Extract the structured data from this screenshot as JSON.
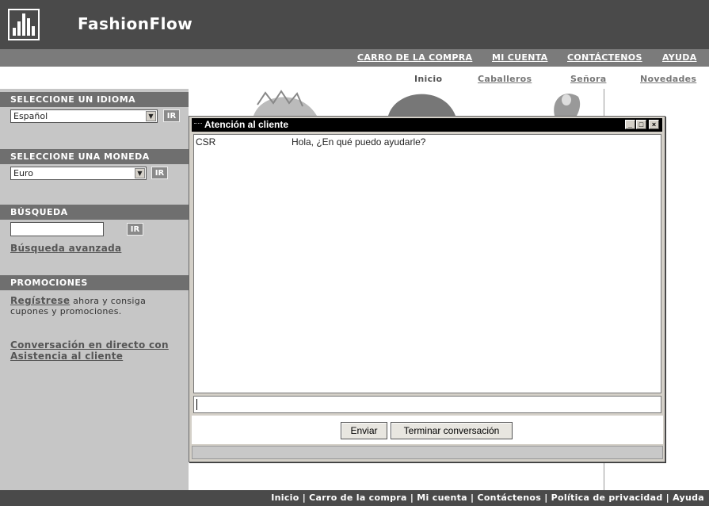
{
  "brand": {
    "name": "FashionFlow"
  },
  "topnav": [
    "CARRO DE LA COMPRA",
    "MI CUENTA",
    "CONTÁCTENOS",
    "AYUDA"
  ],
  "subnav": [
    "Inicio",
    "Caballeros",
    "Señora",
    "Novedades"
  ],
  "sidebar": {
    "language": {
      "heading": "SELECCIONE UN IDIOMA",
      "value": "Español",
      "button": "IR"
    },
    "currency": {
      "heading": "SELECCIONE UNA MONEDA",
      "value": "Euro",
      "button": "IR"
    },
    "search": {
      "heading": "BÚSQUEDA",
      "button": "IR",
      "advanced": "Búsqueda avanzada"
    },
    "promotions": {
      "heading": "PROMOCIONES",
      "register_link": "Regístrese",
      "register_text_1": "ahora y consiga",
      "register_text_2": "cupones y promociones.",
      "chat_link_1": "Conversación en directo con",
      "chat_link_2": "Asistencia al cliente"
    }
  },
  "chat": {
    "title": "Atención al cliente",
    "messages": [
      {
        "sender": "CSR",
        "text": "Hola, ¿En qué puedo ayudarle?"
      }
    ],
    "send_button": "Enviar",
    "end_button": "Terminar conversación"
  },
  "footer": {
    "text": "Inicio | Carro de la compra | Mi cuenta | Contáctenos | Política de privacidad | Ayuda"
  },
  "colors": {
    "header": "#4a4a4a",
    "topnav": "#7b7b7b",
    "sidebar": "#c6c6c6",
    "section_head": "#6f6f6f",
    "chat_title": "#000000"
  }
}
